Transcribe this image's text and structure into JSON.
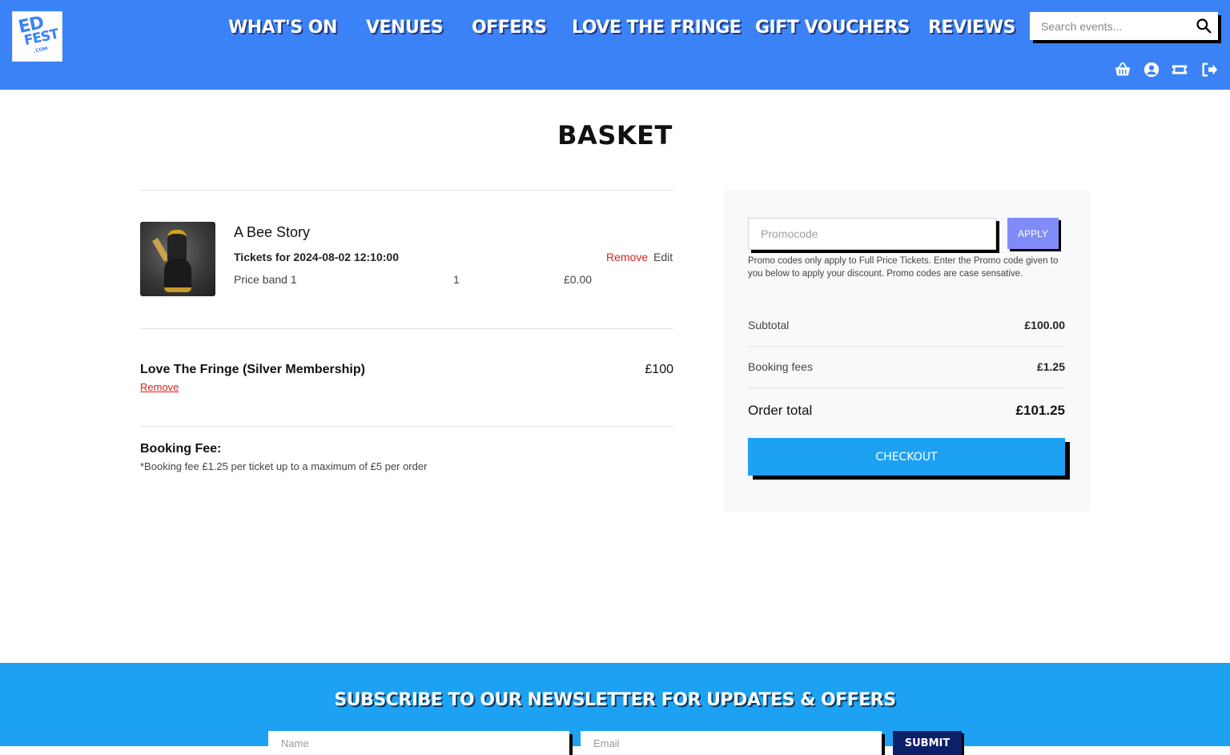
{
  "brand": {
    "logo_line1": "ED",
    "logo_line2": "FEST",
    "logo_line3": ".COM",
    "primary_color": "#3b82f6",
    "accent_color": "#1da1f2"
  },
  "nav": {
    "items": [
      {
        "label": "WHAT'S ON"
      },
      {
        "label": "VENUES"
      },
      {
        "label": "OFFERS"
      },
      {
        "label": "LOVE THE FRINGE"
      },
      {
        "label": "GIFT VOUCHERS"
      },
      {
        "label": "REVIEWS"
      }
    ],
    "search_placeholder": "Search events...",
    "icons": [
      "basket-icon",
      "account-icon",
      "ticket-icon",
      "logout-icon"
    ]
  },
  "page": {
    "title": "BASKET"
  },
  "basket": {
    "event": {
      "title": "A Bee Story",
      "subtitle": "Tickets for 2024-08-02 12:10:00",
      "price_band": "Price band 1",
      "quantity": "1",
      "price": "£0.00",
      "remove_label": "Remove",
      "edit_label": "Edit"
    },
    "membership": {
      "title": "Love The Fringe (Silver Membership)",
      "price": "£100",
      "remove_label": "Remove"
    },
    "booking_fee": {
      "title": "Booking Fee:",
      "note": "*Booking fee £1.25 per ticket up to a maximum of £5 per order"
    }
  },
  "summary": {
    "promo_placeholder": "Promocode",
    "apply_label": "APPLY",
    "promo_note": "Promo codes only apply to Full Price Tickets. Enter the Promo code given to you below to apply your discount. Promo codes are case sensative.",
    "subtotal_label": "Subtotal",
    "subtotal_value": "£100.00",
    "fees_label": "Booking fees",
    "fees_value": "£1.25",
    "total_label": "Order total",
    "total_value": "£101.25",
    "checkout_label": "CHECKOUT"
  },
  "footer": {
    "title": "SUBSCRIBE TO OUR NEWSLETTER FOR UPDATES & OFFERS",
    "name_placeholder": "Name",
    "email_placeholder": "Email",
    "submit_label": "SUBMIT"
  }
}
